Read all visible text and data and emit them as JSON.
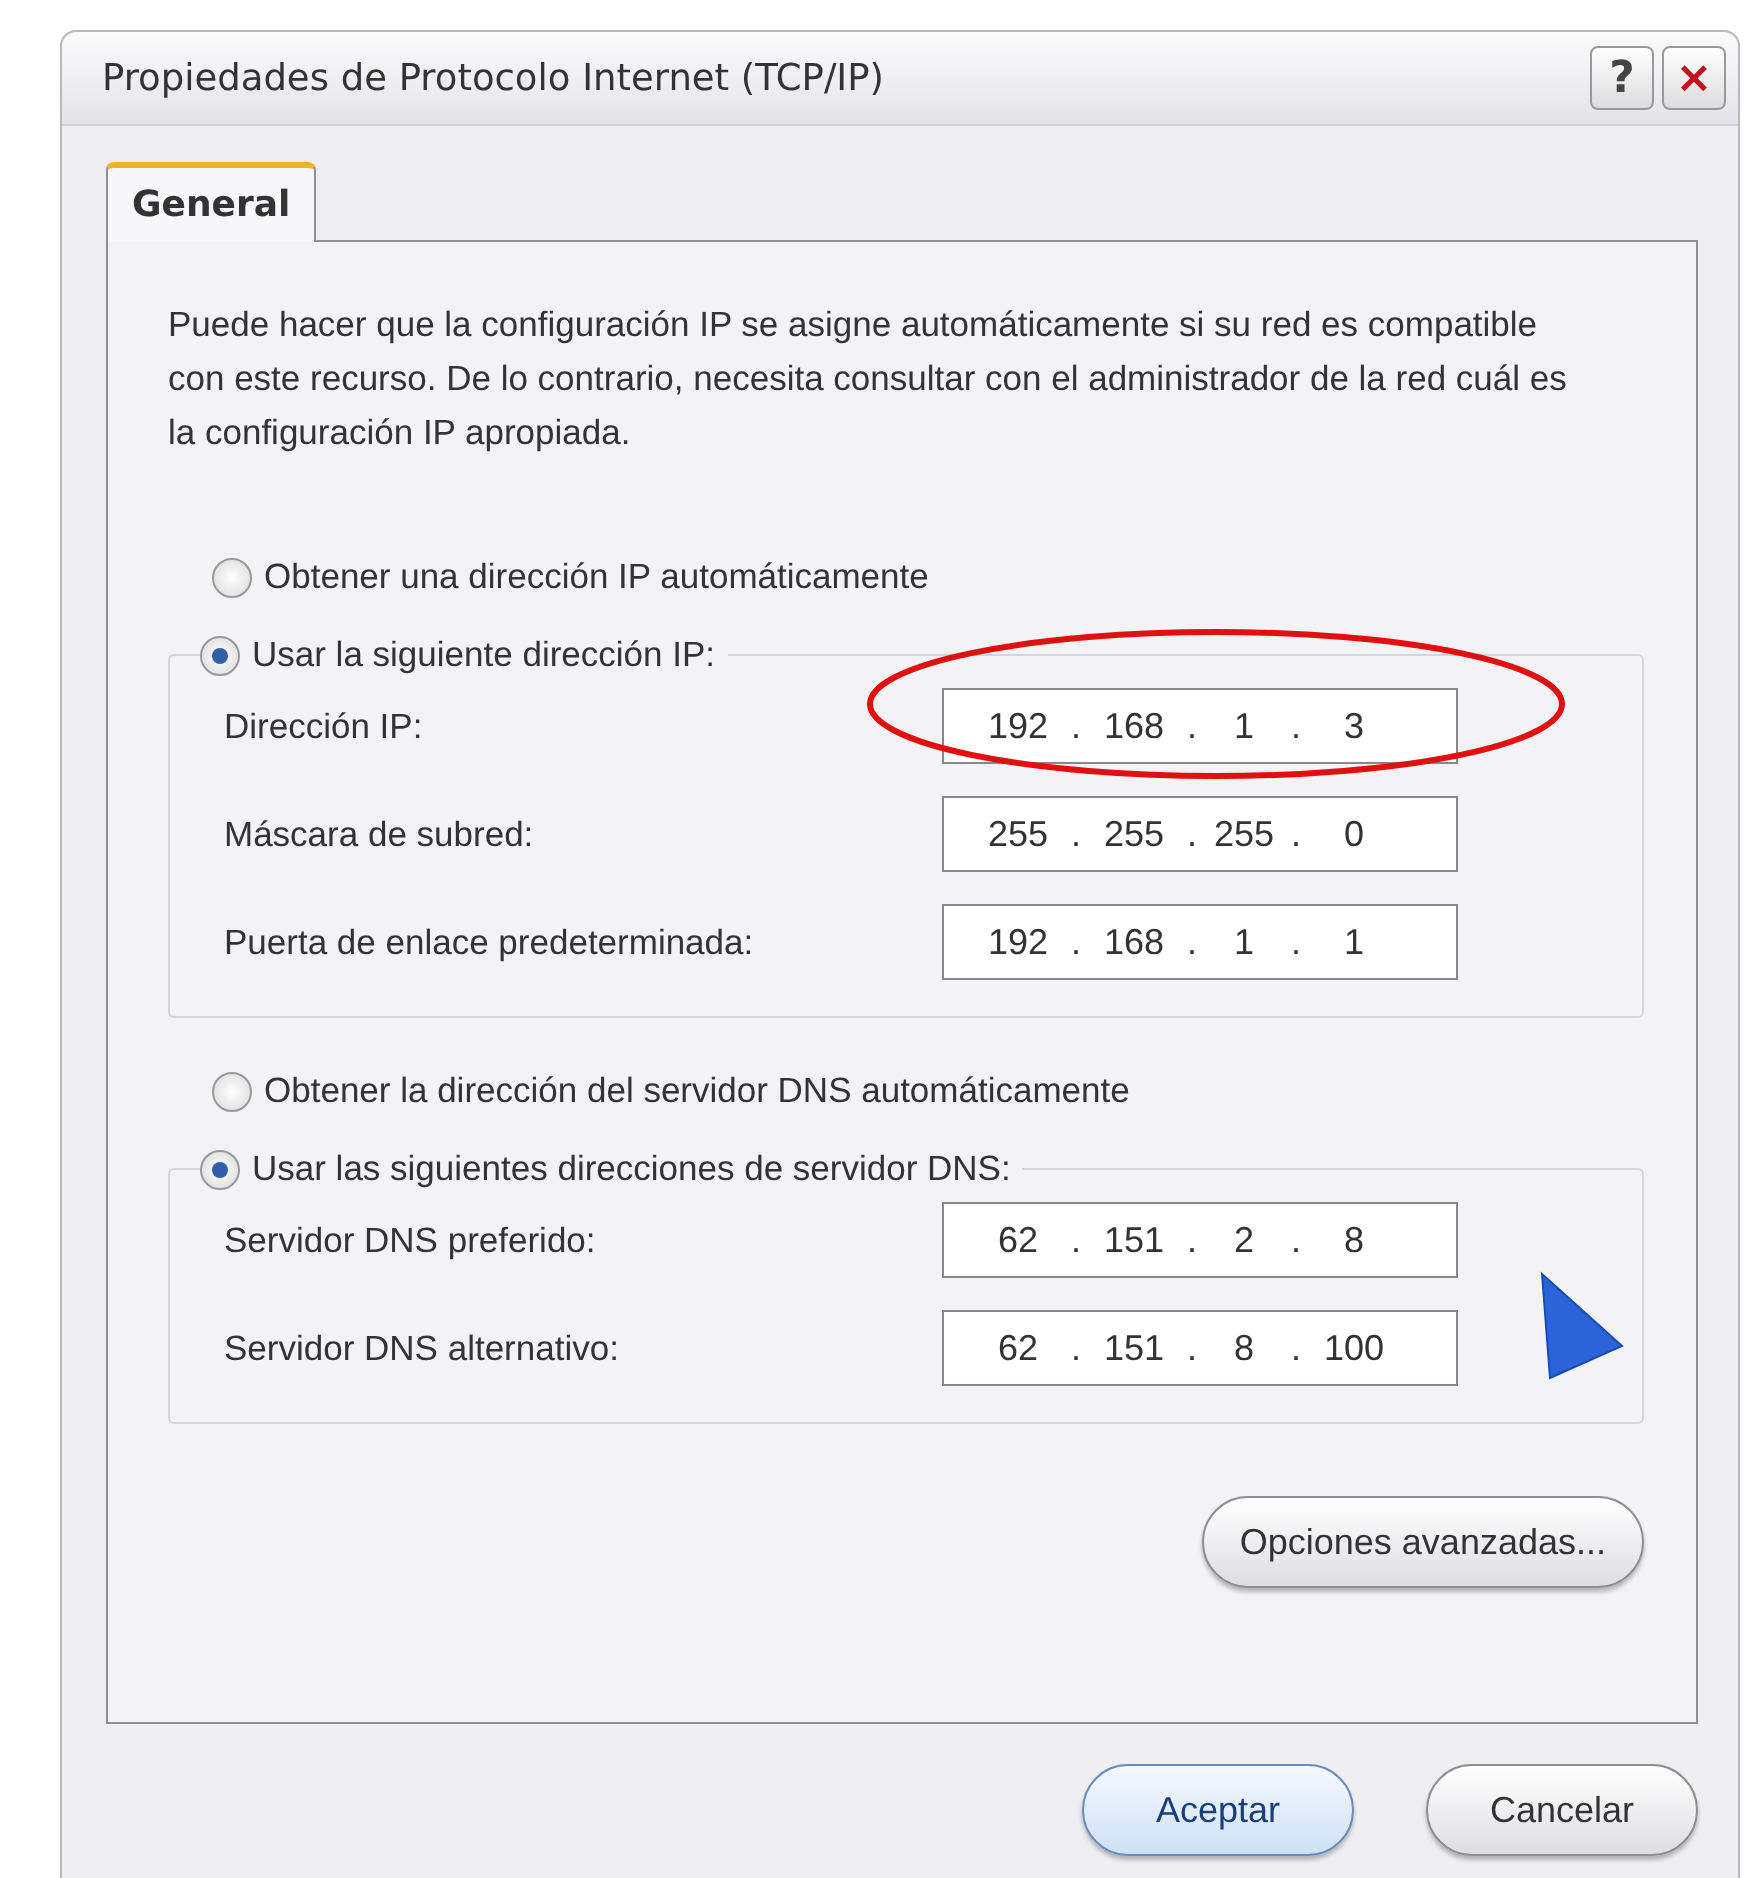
{
  "window": {
    "title": "Propiedades de Protocolo Internet (TCP/IP)",
    "help_button": "?",
    "close_button": "×"
  },
  "tabs": [
    {
      "label": "General",
      "selected": true
    }
  ],
  "intro": "Puede hacer que la configuración IP se asigne automáticamente si su red es compatible con este recurso. De lo contrario, necesita consultar con el administrador de la red cuál es la configuración IP apropiada.",
  "sections": [
    {
      "auto_option": {
        "label": "Obtener una dirección IP automáticamente",
        "selected": false
      },
      "manual_option": {
        "label": "Usar la siguiente dirección IP:",
        "selected": true
      },
      "fields": [
        {
          "label": "Dirección IP:",
          "octets": [
            "192",
            "168",
            "1",
            "3"
          ],
          "highlighted": true
        },
        {
          "label": "Máscara de subred:",
          "octets": [
            "255",
            "255",
            "255",
            "0"
          ],
          "highlighted": false
        },
        {
          "label": "Puerta de enlace predeterminada:",
          "octets": [
            "192",
            "168",
            "1",
            "1"
          ],
          "highlighted": false
        }
      ]
    },
    {
      "auto_option": {
        "label": "Obtener la dirección del servidor DNS automáticamente",
        "selected": false
      },
      "manual_option": {
        "label": "Usar las siguientes direcciones de servidor DNS:",
        "selected": true
      },
      "fields": [
        {
          "label": "Servidor DNS preferido:",
          "octets": [
            "62",
            "151",
            "2",
            "8"
          ],
          "highlighted": false
        },
        {
          "label": "Servidor DNS alternativo:",
          "octets": [
            "62",
            "151",
            "8",
            "100"
          ],
          "highlighted": false
        }
      ]
    }
  ],
  "octet_separator": ".",
  "advanced_button": "Opciones avanzadas...",
  "buttons": [
    {
      "label": "Aceptar",
      "kind": "default"
    },
    {
      "label": "Cancelar",
      "kind": "normal"
    }
  ]
}
